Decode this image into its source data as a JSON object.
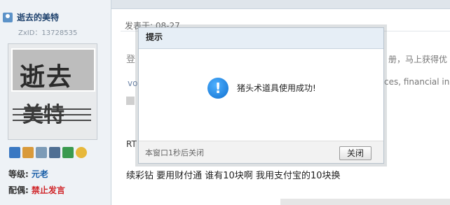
{
  "user": {
    "name": "逝去的美特",
    "zxid": "ZxID：13728535",
    "avatar_text_top": "逝去",
    "avatar_text_bottom": "美特",
    "level_label": "等级:",
    "level_value": "元老",
    "title_label": "配偶:",
    "title_value": "禁止发言"
  },
  "post": {
    "time": "发表于: 08-27",
    "faint_line1": "登",
    "faint_line2": "voi",
    "right_text1": "册，马上获得优",
    "right_text2": "ces, financial ins",
    "rt_text": "RT",
    "body": "续彩钻  要用财付通  谁有10块啊  我用支付宝的10块换"
  },
  "dialog": {
    "title": "提示",
    "message": "猪头术道具使用成功!",
    "auto_close": "本窗口1秒后关闭",
    "close_button": "关闭"
  }
}
